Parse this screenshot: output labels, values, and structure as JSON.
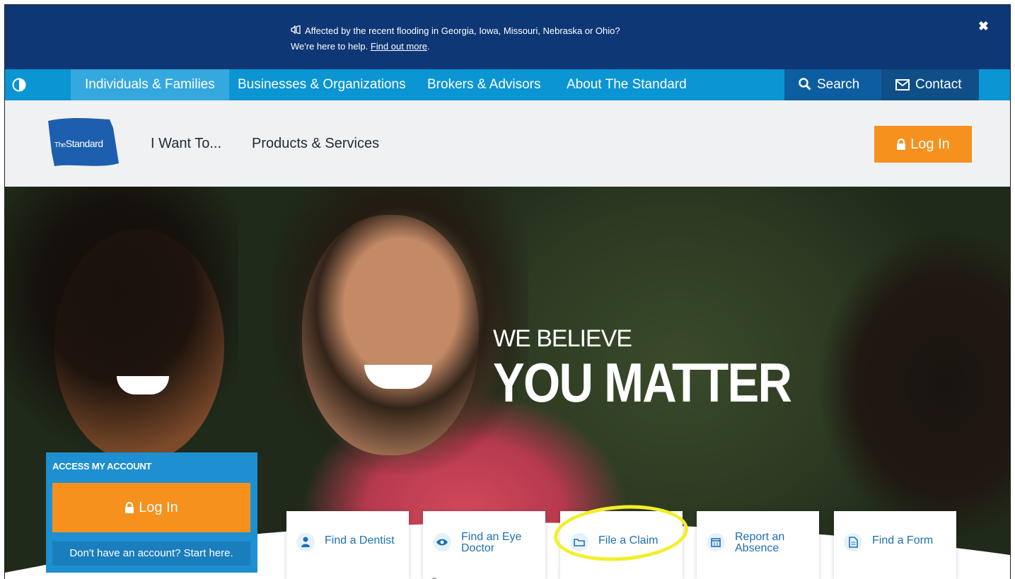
{
  "alert": {
    "line1": "Affected by the recent flooding in Georgia, Iowa, Missouri, Nebraska or Ohio?",
    "line2_prefix": "We're here to help.",
    "link": "Find out more",
    "line2_suffix": ".",
    "close": "✖"
  },
  "topnav": {
    "items": [
      "Individuals & Families",
      "Businesses & Organizations",
      "Brokers & Advisors",
      "About The Standard"
    ],
    "search": "Search",
    "contact": "Contact"
  },
  "header": {
    "logo_the": "The",
    "logo_standard": "Standard",
    "nav": [
      "I Want To...",
      "Products & Services"
    ],
    "login": "Log In"
  },
  "hero": {
    "title_small": "WE BELIEVE",
    "title_large": "YOU MATTER"
  },
  "account": {
    "title": "ACCESS MY ACCOUNT",
    "login": "Log In",
    "start": "Don't have an account? Start here."
  },
  "quick_links": [
    {
      "label": "Find a Dentist",
      "icon": "dentist-icon"
    },
    {
      "label_1": "Find an Eye",
      "label_2": "Doctor",
      "icon": "eye-icon"
    },
    {
      "label": "File a Claim",
      "icon": "folder-icon"
    },
    {
      "label_1": "Report an",
      "label_2": "Absence",
      "icon": "calendar-icon"
    },
    {
      "label": "Find a Form",
      "icon": "document-icon"
    }
  ],
  "colors": {
    "banner": "#0e3775",
    "nav": "#0b95d3",
    "accent_orange": "#f6911e",
    "highlight": "#f2ef2a"
  }
}
